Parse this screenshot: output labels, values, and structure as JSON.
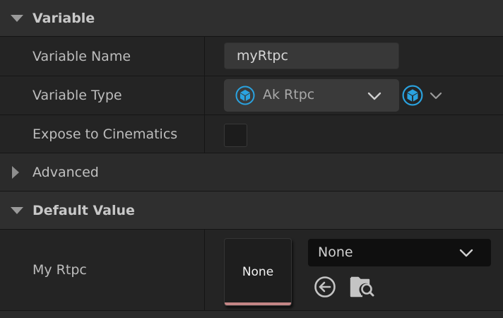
{
  "categories": {
    "variable": "Variable",
    "advanced": "Advanced",
    "default_value": "Default Value"
  },
  "variable_name": {
    "label": "Variable Name",
    "value": "myRtpc"
  },
  "variable_type": {
    "label": "Variable Type",
    "value": "Ak Rtpc",
    "type_icon": "cube-icon",
    "accent_color": "#2aa3e0"
  },
  "expose_to_cinematics": {
    "label": "Expose to Cinematics",
    "checked": false
  },
  "my_rtpc": {
    "label": "My Rtpc",
    "thumbnail_label": "None",
    "asset_value": "None",
    "thumbnail_bar_color": "#c48686"
  },
  "icons": {
    "collapse": "triangle-down-icon",
    "expand": "triangle-right-icon",
    "dropdown": "chevron-down-icon",
    "use_selected": "arrow-left-circle-icon",
    "browse": "folder-search-icon"
  }
}
